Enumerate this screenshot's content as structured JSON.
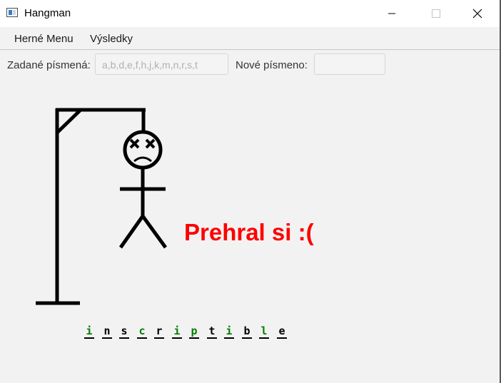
{
  "window": {
    "title": "Hangman"
  },
  "menu": {
    "items": [
      {
        "label": "Herné Menu"
      },
      {
        "label": "Výsledky"
      }
    ]
  },
  "inputs": {
    "guessed_label": "Zadané písmená:",
    "guessed_value": "a,b,d,e,f,h,j,k,m,n,r,s,t",
    "new_label": "Nové písmeno:",
    "new_value": ""
  },
  "result": {
    "text": "Prehral si :(",
    "color": "#ff0000"
  },
  "word": {
    "letters": [
      {
        "char": "i",
        "color": "#008000"
      },
      {
        "char": "n",
        "color": "#000000"
      },
      {
        "char": "s",
        "color": "#000000"
      },
      {
        "char": "c",
        "color": "#008000"
      },
      {
        "char": "r",
        "color": "#000000"
      },
      {
        "char": "i",
        "color": "#008000"
      },
      {
        "char": "p",
        "color": "#008000"
      },
      {
        "char": "t",
        "color": "#000000"
      },
      {
        "char": "i",
        "color": "#008000"
      },
      {
        "char": "b",
        "color": "#000000"
      },
      {
        "char": "l",
        "color": "#008000"
      },
      {
        "char": "e",
        "color": "#000000"
      }
    ]
  },
  "icons": {
    "app": "window-app-icon",
    "minimize": "minimize-icon",
    "maximize": "maximize-icon",
    "close": "close-icon"
  }
}
